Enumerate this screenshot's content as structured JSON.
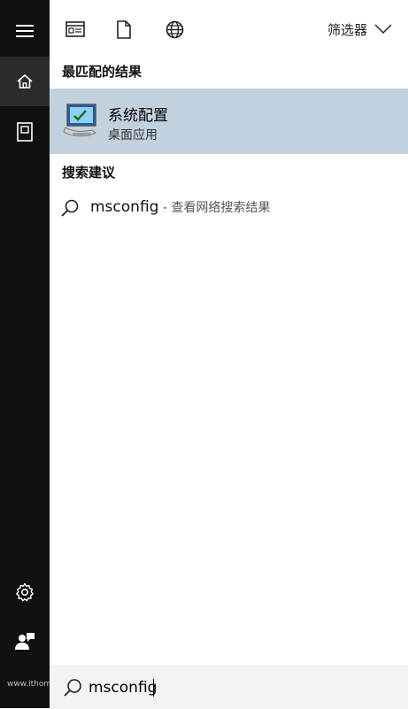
{
  "topbar": {
    "filter_label": "筛选器"
  },
  "best_match": {
    "section_title": "最匹配的结果",
    "app_name": "系统配置",
    "app_type": "桌面应用"
  },
  "suggestions": {
    "section_title": "搜索建议",
    "items": [
      {
        "query": "msconfig",
        "sub": " - 查看网络搜索结果"
      }
    ]
  },
  "search": {
    "value": "msconfig"
  },
  "watermark": "www.ithome.com",
  "colors": {
    "sidebar": "#111111",
    "highlight": "#c2d1de",
    "searchbox": "#f3f3f3"
  }
}
